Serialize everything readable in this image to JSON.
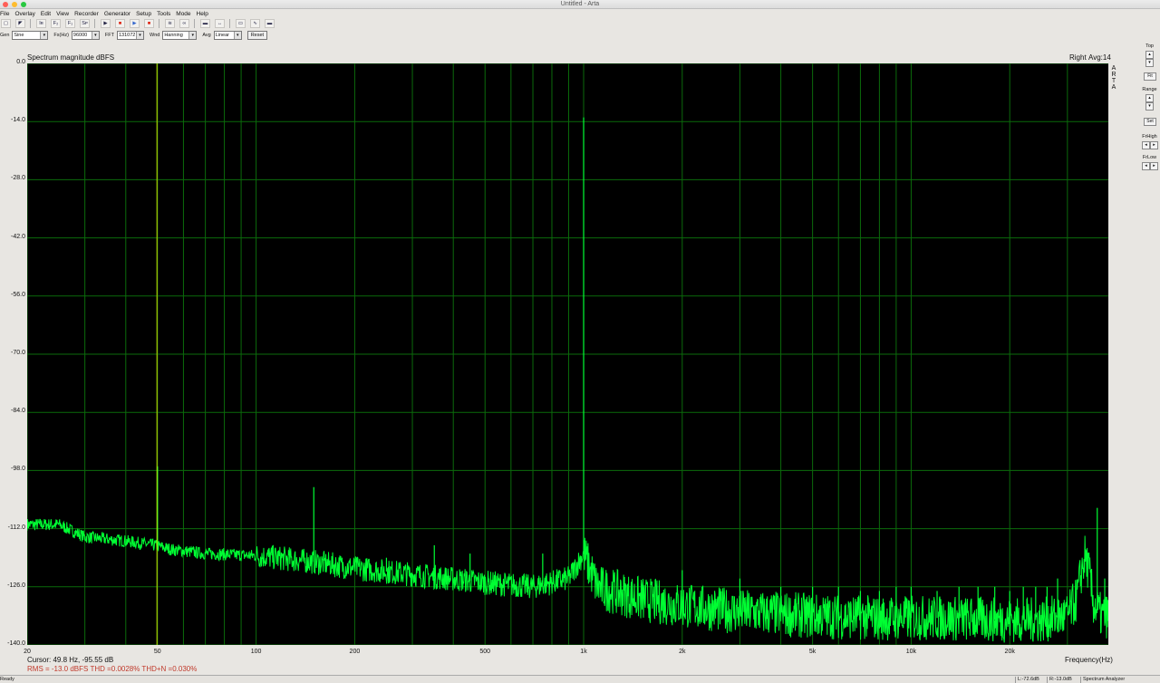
{
  "window": {
    "title": "Untitled - Arta"
  },
  "menu": [
    "File",
    "Overlay",
    "Edit",
    "View",
    "Recorder",
    "Generator",
    "Setup",
    "Tools",
    "Mode",
    "Help"
  ],
  "toolbar": [
    {
      "icon": "new-icon",
      "glyph": "▢"
    },
    {
      "icon": "open-icon",
      "glyph": "◤"
    },
    {
      "icon": "impulse-mode-icon",
      "glyph": "Iʀ"
    },
    {
      "icon": "fr2-mode-icon",
      "glyph": "F₂"
    },
    {
      "icon": "fr1-mode-icon",
      "glyph": "F₁"
    },
    {
      "icon": "spectrum-mode-icon",
      "glyph": "Sᴘ"
    },
    {
      "icon": "play-icon",
      "glyph": "▶"
    },
    {
      "icon": "record-icon",
      "glyph": "■"
    },
    {
      "icon": "play-record-icon",
      "glyph": "▶"
    },
    {
      "icon": "stop-icon",
      "glyph": "■"
    },
    {
      "icon": "generator-icon",
      "glyph": "≋"
    },
    {
      "icon": "compare-icon",
      "glyph": "∞"
    },
    {
      "icon": "grid-icon",
      "glyph": "▬"
    },
    {
      "icon": "link-icon",
      "glyph": "↔"
    },
    {
      "icon": "overlay-icon",
      "glyph": "▭"
    },
    {
      "icon": "scope-icon",
      "glyph": "∿"
    },
    {
      "icon": "meter-icon",
      "glyph": "▬"
    }
  ],
  "controls": {
    "gen_label": "Gen",
    "gen_value": "Sine",
    "fs_label": "Fs(Hz)",
    "fs_value": "96000",
    "fft_label": "FFT",
    "fft_value": "131072",
    "wnd_label": "Wnd",
    "wnd_value": "Hanning",
    "avg_label": "Avg",
    "avg_value": "Linear",
    "reset_label": "Reset"
  },
  "plot": {
    "title": "Spectrum magnitude dBFS",
    "channel": "Right",
    "avg_info": "Avg:14",
    "side_text": [
      "A",
      "R",
      "T",
      "A"
    ],
    "xlabel": "Frequency(Hz)",
    "colors": {
      "background": "#000000",
      "grid": "#0b6b0b",
      "trace": "#00ff33",
      "marker": "#c8e000"
    }
  },
  "right_panel": {
    "top_label": "Top",
    "fit_label": "Fit",
    "range_label": "Range",
    "set_label": "Set",
    "frhigh_label": "FrHigh",
    "frlow_label": "FrLow",
    "up_glyph": "▴",
    "down_glyph": "▾",
    "left_glyph": "◂",
    "right_glyph": "▸"
  },
  "readout": {
    "cursor": "Cursor:   49.8 Hz, -95.55 dB",
    "rms": "RMS =  -13.0 dBFS   THD =0.0028%   THD+N =0.030%"
  },
  "status": {
    "ready": "Ready",
    "left_level": "L:-72.6dB",
    "right_level": "R:-13.0dB",
    "mode": "Spectrum Analyzer"
  },
  "chart_data": {
    "type": "line",
    "title": "Spectrum magnitude dBFS",
    "xlabel": "Frequency(Hz)",
    "ylabel": "",
    "xscale": "log",
    "xlim": [
      20,
      40000
    ],
    "ylim": [
      -140,
      0
    ],
    "grid": true,
    "y_ticks": [
      "0.0",
      "-14.0",
      "-28.0",
      "-42.0",
      "-56.0",
      "-70.0",
      "-84.0",
      "-98.0",
      "-112.0",
      "-126.0",
      "-140.0"
    ],
    "x_tick_labels": [
      {
        "value": 20,
        "label": "20"
      },
      {
        "value": 50,
        "label": "50"
      },
      {
        "value": 100,
        "label": "100"
      },
      {
        "value": 200,
        "label": "200"
      },
      {
        "value": 500,
        "label": "500"
      },
      {
        "value": 1000,
        "label": "1k"
      },
      {
        "value": 2000,
        "label": "2k"
      },
      {
        "value": 5000,
        "label": "5k"
      },
      {
        "value": 10000,
        "label": "10k"
      },
      {
        "value": 20000,
        "label": "20k"
      }
    ],
    "x_minor_gridlines": [
      30,
      40,
      60,
      70,
      80,
      90,
      300,
      400,
      600,
      700,
      800,
      900,
      3000,
      4000,
      6000,
      7000,
      8000,
      9000,
      30000
    ],
    "cursor_x": 49.8,
    "noise_floor": [
      {
        "x": 20,
        "y": -111
      },
      {
        "x": 25,
        "y": -111
      },
      {
        "x": 30,
        "y": -114
      },
      {
        "x": 40,
        "y": -115
      },
      {
        "x": 49,
        "y": -116
      },
      {
        "x": 55,
        "y": -117
      },
      {
        "x": 70,
        "y": -118
      },
      {
        "x": 100,
        "y": -118.5
      },
      {
        "x": 150,
        "y": -120
      },
      {
        "x": 200,
        "y": -121.5
      },
      {
        "x": 300,
        "y": -123
      },
      {
        "x": 500,
        "y": -125
      },
      {
        "x": 700,
        "y": -126
      },
      {
        "x": 900,
        "y": -124
      },
      {
        "x": 1000,
        "y": -118
      },
      {
        "x": 1100,
        "y": -126
      },
      {
        "x": 1500,
        "y": -129
      },
      {
        "x": 2000,
        "y": -130.5
      },
      {
        "x": 3000,
        "y": -132
      },
      {
        "x": 5000,
        "y": -133
      },
      {
        "x": 8000,
        "y": -133.5
      },
      {
        "x": 12000,
        "y": -133.5
      },
      {
        "x": 20000,
        "y": -134
      },
      {
        "x": 25000,
        "y": -134
      },
      {
        "x": 30000,
        "y": -133
      },
      {
        "x": 32000,
        "y": -129
      },
      {
        "x": 33000,
        "y": -123
      },
      {
        "x": 34000,
        "y": -118.5
      },
      {
        "x": 35000,
        "y": -123
      },
      {
        "x": 36000,
        "y": -130
      },
      {
        "x": 38000,
        "y": -133
      },
      {
        "x": 40000,
        "y": -133
      }
    ],
    "peaks": [
      {
        "x": 50,
        "y": -97
      },
      {
        "x": 150,
        "y": -102
      },
      {
        "x": 250,
        "y": -119
      },
      {
        "x": 350,
        "y": -116
      },
      {
        "x": 450,
        "y": -118
      },
      {
        "x": 750,
        "y": -118
      },
      {
        "x": 1000,
        "y": -13
      },
      {
        "x": 2000,
        "y": -122
      },
      {
        "x": 3000,
        "y": -124
      },
      {
        "x": 4000,
        "y": -126
      },
      {
        "x": 5000,
        "y": -126
      },
      {
        "x": 6000,
        "y": -126
      },
      {
        "x": 7000,
        "y": -127
      },
      {
        "x": 8000,
        "y": -127
      },
      {
        "x": 9000,
        "y": -126
      },
      {
        "x": 10000,
        "y": -126
      },
      {
        "x": 12000,
        "y": -127
      },
      {
        "x": 14000,
        "y": -126
      },
      {
        "x": 16000,
        "y": -126
      },
      {
        "x": 18000,
        "y": -126
      },
      {
        "x": 20000,
        "y": -127
      },
      {
        "x": 22000,
        "y": -126
      },
      {
        "x": 24000,
        "y": -126
      },
      {
        "x": 26000,
        "y": -126
      },
      {
        "x": 28000,
        "y": -124
      },
      {
        "x": 37000,
        "y": -107
      },
      {
        "x": 39000,
        "y": -124
      }
    ]
  }
}
